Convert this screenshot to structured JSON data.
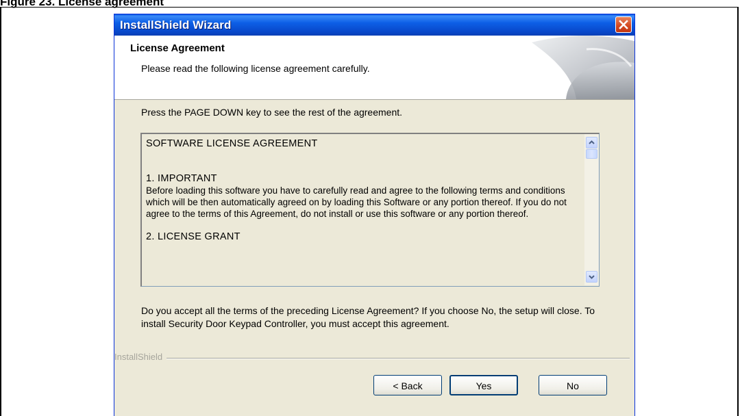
{
  "document": {
    "caption": "Figure 23. License agreement"
  },
  "window": {
    "title": "InstallShield Wizard"
  },
  "header": {
    "title": "License Agreement",
    "subtitle": "Please read the following license agreement carefully."
  },
  "instruction": "Press the PAGE DOWN key to see the rest of the agreement.",
  "license": {
    "heading": "SOFTWARE LICENSE AGREEMENT",
    "section1_title": "1. IMPORTANT",
    "section1_body": "Before loading this software you have to carefully read and agree to the following terms and conditions which will be then automatically agreed on by loading this Software or any portion thereof. If you do not agree to the terms of this Agreement, do not install or use this software or any portion thereof.",
    "section2_title": "2. LICENSE GRANT"
  },
  "question": "Do you accept all the terms of the preceding License Agreement?  If you choose No,  the setup will close.  To install Security Door Keypad Controller, you must accept this agreement.",
  "brand": "InstallShield",
  "buttons": {
    "back": "< Back",
    "yes": "Yes",
    "no": "No"
  },
  "icons": {
    "close": "close-icon",
    "scroll_up": "chevron-up-icon",
    "scroll_down": "chevron-down-icon"
  }
}
